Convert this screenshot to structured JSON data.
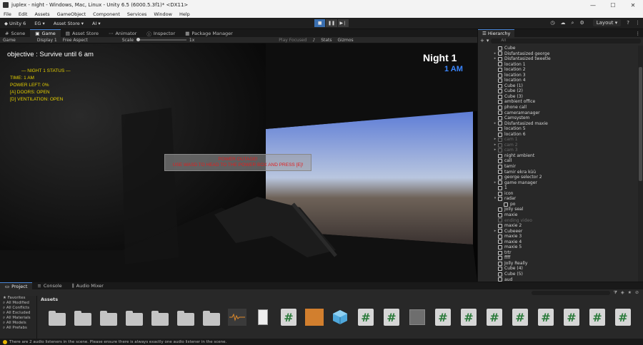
{
  "titlebar": {
    "title": "juplex - night - Windows, Mac, Linux - Unity 6.5 (6000.5.3f1)* <DX11>"
  },
  "menu": [
    "File",
    "Edit",
    "Assets",
    "GameObject",
    "Component",
    "Services",
    "Window",
    "Help"
  ],
  "toolbar": {
    "unity_label": "Unity 6",
    "account": "EG",
    "asset_store": "Asset Store",
    "ai": "AI",
    "layout": "Layout"
  },
  "tabs": [
    "Scene",
    "Game",
    "Asset Store",
    "Animator",
    "Inspector",
    "Package Manager"
  ],
  "active_tab": "Game",
  "game_bar": {
    "mode": "Game",
    "display": "Display 1",
    "aspect": "Free Aspect",
    "scale_label": "Scale",
    "scale_value": "1x",
    "play_focused": "Play Focused",
    "stats": "Stats",
    "gizmos": "Gizmos"
  },
  "hud": {
    "objective": "objective :  Survive until 6 am",
    "night": "Night 1",
    "hour": "1 AM",
    "status_lines": [
      "— NIGHT 1 STATUS —",
      "TIME: 1 AM",
      "POWER LEFT: 0%",
      "[A] DOORS: OPEN",
      "[D] VENTILATION: OPEN"
    ],
    "outage_line1": "POWER OUTAGE!",
    "outage_line2": "USE WASD TO HEAD TO THE POWER BOX AND PRESS [E]!"
  },
  "hierarchy": {
    "title": "Hierarchy",
    "search_placeholder": "All",
    "items": [
      {
        "label": "Cube",
        "arrow": "",
        "dim": false
      },
      {
        "label": "Disfantasized george",
        "arrow": "▸",
        "dim": false
      },
      {
        "label": "Disfantasized tweetle",
        "arrow": "▸",
        "dim": false
      },
      {
        "label": "location 1",
        "arrow": "",
        "dim": false
      },
      {
        "label": "location 2",
        "arrow": "",
        "dim": false
      },
      {
        "label": "location 3",
        "arrow": "",
        "dim": false
      },
      {
        "label": "location 4",
        "arrow": "",
        "dim": false
      },
      {
        "label": "Cube (1)",
        "arrow": "",
        "dim": false
      },
      {
        "label": "Cube (2)",
        "arrow": "",
        "dim": false
      },
      {
        "label": "Cube (3)",
        "arrow": "",
        "dim": false
      },
      {
        "label": "ambient office",
        "arrow": "",
        "dim": false
      },
      {
        "label": "phone call",
        "arrow": "",
        "dim": false
      },
      {
        "label": "cameramanager",
        "arrow": "",
        "dim": false
      },
      {
        "label": "Camsystem",
        "arrow": "",
        "dim": false
      },
      {
        "label": "Disfantasized maxie",
        "arrow": "▸",
        "dim": false
      },
      {
        "label": "location 5",
        "arrow": "",
        "dim": false
      },
      {
        "label": "location 6",
        "arrow": "",
        "dim": false
      },
      {
        "label": "cam 1",
        "arrow": "▸",
        "dim": true
      },
      {
        "label": "cam 2",
        "arrow": "▸",
        "dim": true
      },
      {
        "label": "cam 3",
        "arrow": "▸",
        "dim": true
      },
      {
        "label": "night ambient",
        "arrow": "",
        "dim": false
      },
      {
        "label": "call",
        "arrow": "",
        "dim": false
      },
      {
        "label": "tamir",
        "arrow": "",
        "dim": false
      },
      {
        "label": "tamir ekra küü",
        "arrow": "",
        "dim": false
      },
      {
        "label": "george selector 2",
        "arrow": "",
        "dim": false
      },
      {
        "label": "game manager",
        "arrow": "▸",
        "dim": false
      },
      {
        "label": "1",
        "arrow": "",
        "dim": false
      },
      {
        "label": "icon",
        "arrow": "",
        "dim": false
      },
      {
        "label": "radar",
        "arrow": "▾",
        "dim": false
      },
      {
        "label": "po",
        "arrow": "",
        "dim": false,
        "indent": true
      },
      {
        "label": "Jolly seal",
        "arrow": "",
        "dim": false
      },
      {
        "label": "maxie",
        "arrow": "",
        "dim": false
      },
      {
        "label": "ending video",
        "arrow": "",
        "dim": true
      },
      {
        "label": "maxie 2",
        "arrow": "",
        "dim": false
      },
      {
        "label": "Cubeeer",
        "arrow": "▸",
        "dim": false
      },
      {
        "label": "maxie 3",
        "arrow": "",
        "dim": false
      },
      {
        "label": "maxie 4",
        "arrow": "",
        "dim": false
      },
      {
        "label": "maxie 5",
        "arrow": "",
        "dim": false
      },
      {
        "label": "trtr",
        "arrow": "",
        "dim": false
      },
      {
        "label": "ffff",
        "arrow": "",
        "dim": false
      },
      {
        "label": "Jolly Really",
        "arrow": "",
        "dim": false
      },
      {
        "label": "Cube (4)",
        "arrow": "",
        "dim": false
      },
      {
        "label": "Cube (5)",
        "arrow": "",
        "dim": false
      },
      {
        "label": "aud",
        "arrow": "",
        "dim": false
      }
    ]
  },
  "bottom_tabs": [
    "Project",
    "Console",
    "Audio Mixer"
  ],
  "favorites": {
    "title": "Favorites",
    "items": [
      "All Modified",
      "All Conflicts",
      "All Excluded",
      "All Materials",
      "All Models",
      "All Prefabs"
    ]
  },
  "assets_title": "Assets",
  "assets": [
    "folder",
    "folder",
    "folder",
    "folder",
    "folder",
    "folder",
    "folder",
    "audio",
    "doc",
    "script",
    "audio2",
    "prefab",
    "script",
    "script",
    "mat",
    "script",
    "script",
    "script",
    "script",
    "script",
    "script",
    "script",
    "script"
  ],
  "statusbar": {
    "message": "There are 2 audio listeners in the scene. Please ensure there is always exactly one audio listener in the scene."
  },
  "colors": {
    "accent": "#4a86d6",
    "hour": "#3a86ff",
    "status": "#e6d000",
    "warning": "#e02020"
  }
}
